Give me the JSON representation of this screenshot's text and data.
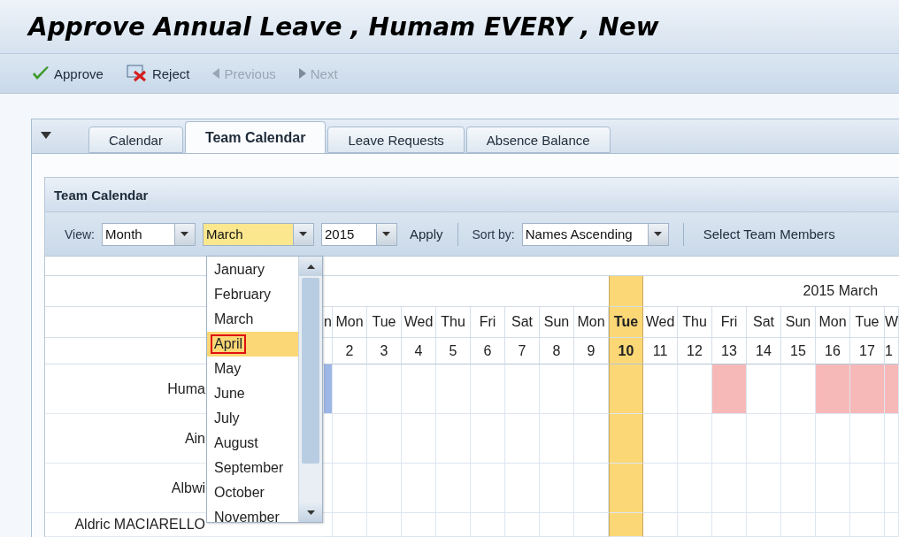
{
  "window": {
    "title": "Approve Annual Leave , Humam EVERY , New"
  },
  "toolbar": [
    {
      "kind": "approve",
      "label": "Approve",
      "disabled": false
    },
    {
      "kind": "reject",
      "label": "Reject",
      "disabled": false
    },
    {
      "kind": "previous",
      "label": "Previous",
      "disabled": true
    },
    {
      "kind": "next",
      "label": "Next",
      "disabled": true
    }
  ],
  "tabs": [
    {
      "label": "Calendar",
      "selected": false
    },
    {
      "label": "Team Calendar",
      "selected": true
    },
    {
      "label": "Leave Requests",
      "selected": false
    },
    {
      "label": "Absence Balance",
      "selected": false
    }
  ],
  "panel": {
    "title": "Team Calendar",
    "filters": [
      {
        "kind": "select",
        "label": "View:",
        "value": "Month",
        "focused": false
      },
      {
        "kind": "select",
        "value": "March",
        "focused": true
      },
      {
        "kind": "select",
        "value": "2015",
        "focused": false
      },
      {
        "kind": "link",
        "label": "Apply"
      },
      {
        "kind": "separator"
      },
      {
        "kind": "select",
        "label": "Sort by:",
        "value": "Names Ascending",
        "focused": false
      },
      {
        "kind": "separator"
      },
      {
        "kind": "link",
        "label": "Select Team Members"
      }
    ],
    "month_list": [
      {
        "label": "January",
        "selected": false
      },
      {
        "label": "February",
        "selected": false
      },
      {
        "label": "March",
        "selected": false
      },
      {
        "label": "April",
        "selected": true
      },
      {
        "label": "May",
        "selected": false
      },
      {
        "label": "June",
        "selected": false
      },
      {
        "label": "July",
        "selected": false
      },
      {
        "label": "August",
        "selected": false
      },
      {
        "label": "September",
        "selected": false
      },
      {
        "label": "October",
        "selected": false
      },
      {
        "label": "November",
        "selected": false
      }
    ],
    "calendar": {
      "month_title": "2015 March",
      "columns": [
        {
          "weekday": "n",
          "selected": false
        },
        {
          "weekday": "Mon",
          "day": "2",
          "selected": false
        },
        {
          "weekday": "Tue",
          "day": "3",
          "selected": false
        },
        {
          "weekday": "Wed",
          "day": "4",
          "selected": false
        },
        {
          "weekday": "Thu",
          "day": "5",
          "selected": false
        },
        {
          "weekday": "Fri",
          "day": "6",
          "selected": false
        },
        {
          "weekday": "Sat",
          "day": "7",
          "selected": false
        },
        {
          "weekday": "Sun",
          "day": "8",
          "selected": false
        },
        {
          "weekday": "Mon",
          "day": "9",
          "selected": false
        },
        {
          "weekday": "Tue",
          "day": "10",
          "selected": true
        },
        {
          "weekday": "Wed",
          "day": "11",
          "selected": false
        },
        {
          "weekday": "Thu",
          "day": "12",
          "selected": false
        },
        {
          "weekday": "Fri",
          "day": "13",
          "selected": false
        },
        {
          "weekday": "Sat",
          "day": "14",
          "selected": false
        },
        {
          "weekday": "Sun",
          "day": "15",
          "selected": false
        },
        {
          "weekday": "Mon",
          "day": "16",
          "selected": false
        },
        {
          "weekday": "Tue",
          "day": "17",
          "selected": false
        },
        {
          "weekday": "W",
          "day": "1",
          "selected": false
        }
      ],
      "rows": [
        {
          "name": "Huma",
          "cells": [
            {
              "kind": "request"
            },
            {
              "kind": "free"
            },
            {
              "kind": "free"
            },
            {
              "kind": "free"
            },
            {
              "kind": "free"
            },
            {
              "kind": "free"
            },
            {
              "kind": "free"
            },
            {
              "kind": "free"
            },
            {
              "kind": "free"
            },
            {
              "kind": "free"
            },
            {
              "kind": "free"
            },
            {
              "kind": "free"
            },
            {
              "kind": "leave"
            },
            {
              "kind": "free"
            },
            {
              "kind": "free"
            },
            {
              "kind": "leave"
            },
            {
              "kind": "leave"
            },
            {
              "kind": "leave"
            }
          ]
        },
        {
          "name": "Ain",
          "cells": [
            {
              "kind": "free"
            },
            {
              "kind": "free"
            },
            {
              "kind": "free"
            },
            {
              "kind": "free"
            },
            {
              "kind": "free"
            },
            {
              "kind": "free"
            },
            {
              "kind": "free"
            },
            {
              "kind": "free"
            },
            {
              "kind": "free"
            },
            {
              "kind": "free"
            },
            {
              "kind": "free"
            },
            {
              "kind": "free"
            },
            {
              "kind": "free"
            },
            {
              "kind": "free"
            },
            {
              "kind": "free"
            },
            {
              "kind": "free"
            },
            {
              "kind": "free"
            },
            {
              "kind": "free"
            }
          ]
        },
        {
          "name": "Albwi",
          "cells": [
            {
              "kind": "free"
            },
            {
              "kind": "free"
            },
            {
              "kind": "free"
            },
            {
              "kind": "free"
            },
            {
              "kind": "free"
            },
            {
              "kind": "free"
            },
            {
              "kind": "free"
            },
            {
              "kind": "free"
            },
            {
              "kind": "free"
            },
            {
              "kind": "free"
            },
            {
              "kind": "free"
            },
            {
              "kind": "free"
            },
            {
              "kind": "free"
            },
            {
              "kind": "free"
            },
            {
              "kind": "free"
            },
            {
              "kind": "free"
            },
            {
              "kind": "free"
            },
            {
              "kind": "free"
            }
          ]
        },
        {
          "name": "Aldric MACIARELLO",
          "cells": [
            {
              "kind": "free"
            },
            {
              "kind": "free"
            },
            {
              "kind": "free"
            },
            {
              "kind": "free"
            },
            {
              "kind": "free"
            },
            {
              "kind": "free"
            },
            {
              "kind": "free"
            },
            {
              "kind": "free"
            },
            {
              "kind": "free"
            },
            {
              "kind": "free"
            },
            {
              "kind": "free"
            },
            {
              "kind": "free"
            },
            {
              "kind": "free"
            },
            {
              "kind": "free"
            },
            {
              "kind": "free"
            },
            {
              "kind": "free"
            },
            {
              "kind": "free"
            },
            {
              "kind": "free"
            }
          ]
        }
      ]
    }
  }
}
